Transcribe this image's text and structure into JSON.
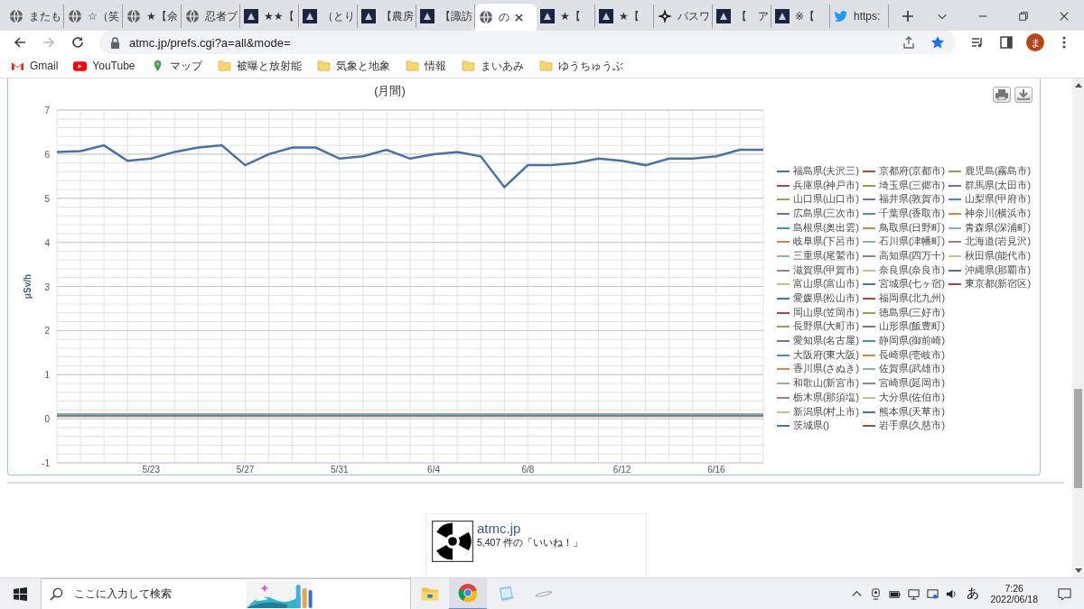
{
  "browser": {
    "tabs": [
      {
        "title": "またも",
        "kind": "globe",
        "selected": false
      },
      {
        "title": "☆（笑",
        "kind": "globe",
        "selected": false
      },
      {
        "title": "★【余",
        "kind": "globe",
        "selected": false
      },
      {
        "title": "忍者ブ",
        "kind": "globe",
        "selected": false
      },
      {
        "title": "★★【",
        "kind": "dark",
        "selected": false
      },
      {
        "title": "（とり",
        "kind": "dark",
        "selected": false
      },
      {
        "title": "【農房",
        "kind": "dark",
        "selected": false
      },
      {
        "title": "【諏訪",
        "kind": "dark",
        "selected": false
      },
      {
        "title": "の",
        "kind": "globe",
        "selected": true
      },
      {
        "title": "★【",
        "kind": "dark",
        "selected": false
      },
      {
        "title": "★【",
        "kind": "dark",
        "selected": false
      },
      {
        "title": "パスワ",
        "kind": "shuriken",
        "selected": false
      },
      {
        "title": "【　ア",
        "kind": "dark",
        "selected": false
      },
      {
        "title": "※【",
        "kind": "dark",
        "selected": false
      },
      {
        "title": "https:",
        "kind": "bird",
        "selected": false
      }
    ],
    "address": "atmc.jp/prefs.cgi?a=all&mode=",
    "profile_initial": "ま",
    "bookmarks": [
      {
        "label": "Gmail",
        "kind": "mail"
      },
      {
        "label": "YouTube",
        "kind": "video"
      },
      {
        "label": "マップ",
        "kind": "map"
      },
      {
        "label": "被曝と放射能",
        "kind": "folder"
      },
      {
        "label": "気象と地象",
        "kind": "folder"
      },
      {
        "label": "情報",
        "kind": "folder"
      },
      {
        "label": "まいあみ",
        "kind": "folder"
      },
      {
        "label": "ゆうちゅうぶ",
        "kind": "folder"
      }
    ]
  },
  "chart_card": {
    "chart_data": {
      "type": "line",
      "title": "(月間)",
      "ylabel": "μSv/h",
      "categories": [
        null,
        null,
        null,
        null,
        "5/23",
        null,
        null,
        null,
        "5/27",
        null,
        null,
        null,
        "5/31",
        null,
        null,
        null,
        "6/4",
        null,
        null,
        null,
        "6/8",
        null,
        null,
        null,
        "6/12",
        null,
        null,
        null,
        "6/16",
        null,
        null
      ],
      "ylim": [
        -1,
        7
      ],
      "grid": true,
      "yticks": [
        -1,
        0,
        1,
        2,
        3,
        4,
        5,
        6,
        7
      ],
      "series": [
        {
          "name": "福島県(夫沢三)",
          "color": "#4572a7",
          "values": [
            6.05,
            6.07,
            6.2,
            5.85,
            5.9,
            6.05,
            6.15,
            6.2,
            5.75,
            6.0,
            6.15,
            6.15,
            5.9,
            5.95,
            6.1,
            5.9,
            6.0,
            6.05,
            5.95,
            5.25,
            5.75,
            5.75,
            5.8,
            5.9,
            5.85,
            5.75,
            5.9,
            5.9,
            5.95,
            6.1,
            6.1
          ]
        }
      ]
    },
    "other_stations": [
      {
        "name": "兵庫県(神戸市)",
        "color": "#aa4643"
      },
      {
        "name": "山口県(山口市)",
        "color": "#89a54e"
      },
      {
        "name": "広島県(三次市)",
        "color": "#80699b"
      },
      {
        "name": "島根県(奥出雲)",
        "color": "#3d96ae"
      },
      {
        "name": "岐阜県(下呂市)",
        "color": "#db843d"
      },
      {
        "name": "三重県(尾鷲市)",
        "color": "#92a8cd"
      },
      {
        "name": "滋賀県(甲賀市)",
        "color": "#a47d7c"
      },
      {
        "name": "富山県(富山市)",
        "color": "#b5ca92"
      },
      {
        "name": "愛媛県(松山市)",
        "color": "#4572a7"
      },
      {
        "name": "岡山県(笠岡市)",
        "color": "#aa4643"
      },
      {
        "name": "長野県(大町市)",
        "color": "#89a54e"
      },
      {
        "name": "愛知県(名古屋)",
        "color": "#80699b"
      },
      {
        "name": "大阪府(東大阪)",
        "color": "#3d96ae"
      },
      {
        "name": "香川県(さぬき)",
        "color": "#db843d"
      },
      {
        "name": "和歌山(新宮市)",
        "color": "#92a8cd"
      },
      {
        "name": "栃木県(那須塩)",
        "color": "#a47d7c"
      },
      {
        "name": "新潟県(村上市)",
        "color": "#b5ca92"
      },
      {
        "name": "茨城県()",
        "color": "#4572a7"
      },
      {
        "name": "京都府(京都市)",
        "color": "#aa4643"
      },
      {
        "name": "埼玉県(三郷市)",
        "color": "#89a54e"
      },
      {
        "name": "福井県(敦賀市)",
        "color": "#80699b"
      },
      {
        "name": "千葉県(香取市)",
        "color": "#3d96ae"
      },
      {
        "name": "鳥取県(日野町)",
        "color": "#db843d"
      },
      {
        "name": "石川県(津幡町)",
        "color": "#92a8cd"
      },
      {
        "name": "高知県(四万十)",
        "color": "#a47d7c"
      },
      {
        "name": "奈良県(奈良市)",
        "color": "#b5ca92"
      },
      {
        "name": "宮城県(七ヶ宿)",
        "color": "#4572a7"
      },
      {
        "name": "福岡県(北九州)",
        "color": "#aa4643"
      },
      {
        "name": "徳島県(三好市)",
        "color": "#89a54e"
      },
      {
        "name": "山形県(飯豊町)",
        "color": "#80699b"
      },
      {
        "name": "静岡県(御前崎)",
        "color": "#3d96ae"
      },
      {
        "name": "長崎県(壱岐市)",
        "color": "#db843d"
      },
      {
        "name": "佐賀県(武雄市)",
        "color": "#92a8cd"
      },
      {
        "name": "宮崎県(延岡市)",
        "color": "#a47d7c"
      },
      {
        "name": "大分県(佐伯市)",
        "color": "#b5ca92"
      },
      {
        "name": "熊本県(天草市)",
        "color": "#4572a7"
      },
      {
        "name": "岩手県(久慈市)",
        "color": "#aa4643"
      },
      {
        "name": "鹿児島(霧島市)",
        "color": "#89a54e"
      },
      {
        "name": "群馬県(太田市)",
        "color": "#80699b"
      },
      {
        "name": "山梨県(甲府市)",
        "color": "#3d96ae"
      },
      {
        "name": "神奈川(横浜市)",
        "color": "#db843d"
      },
      {
        "name": "青森県(深浦町)",
        "color": "#92a8cd"
      },
      {
        "name": "北海道(岩見沢)",
        "color": "#a47d7c"
      },
      {
        "name": "秋田県(能代市)",
        "color": "#b5ca92"
      },
      {
        "name": "沖縄県(那覇市)",
        "color": "#4572a7"
      },
      {
        "name": "東京都(新宿区)",
        "color": "#aa4643"
      }
    ]
  },
  "like_box": {
    "page_name": "atmc.jp",
    "likes": "5,407 件の「いいね！」"
  },
  "taskbar": {
    "search_placeholder": "ここに入力して検索",
    "ime": "あ",
    "time": "7:26",
    "date": "2022/06/18"
  }
}
